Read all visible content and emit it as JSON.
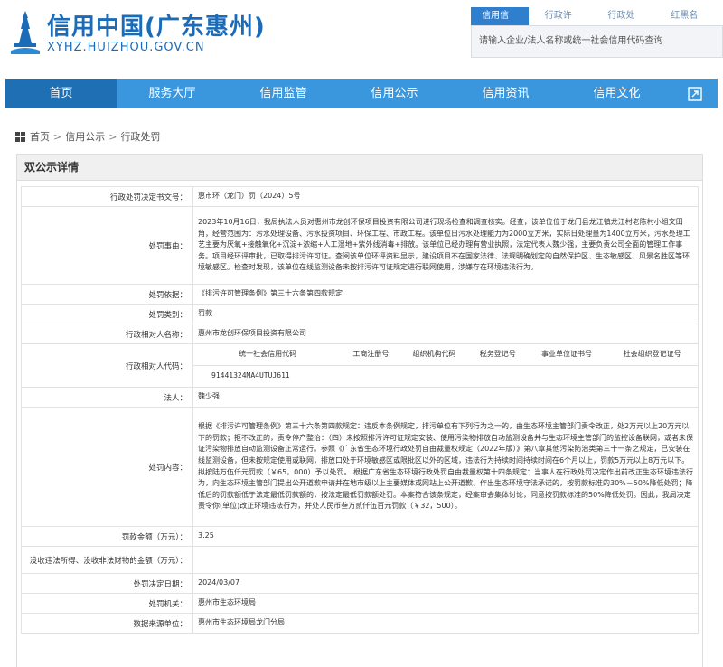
{
  "header": {
    "title": "信用中国(广东惠州)",
    "domain": "XYHZ.HUIZHOU.GOV.CN",
    "logo": "huizhou-tower-logo",
    "brand_color": "#1a6bb8"
  },
  "search": {
    "tabs": [
      "信用信息",
      "行政许可",
      "行政处罚",
      "红黑名单"
    ],
    "active_tab": 0,
    "placeholder": "请输入企业/法人名称或统一社会信用代码查询"
  },
  "nav": {
    "items": [
      "首页",
      "服务大厅",
      "信用监管",
      "信用公示",
      "信用资讯",
      "信用文化"
    ],
    "active": 0,
    "ext_icon": "expand-icon",
    "color": "#3a96dd"
  },
  "breadcrumb": [
    "首页",
    "信用公示",
    "行政处罚"
  ],
  "panel": {
    "title": "双公示详情",
    "rows": {
      "doc_no": {
        "label": "行政处罚决定书文号：",
        "value": "惠市环（龙门）罚（2024）5号"
      },
      "reason": {
        "label": "处罚事由：",
        "value": "2023年10月16日，我局执法人员对惠州市龙创环保项目投资有限公司进行现场检查和调查核实。经查，该单位位于龙门县龙江镇龙江村老陈村小组文田角，经营范围为：污水处理设备、污水投资项目、环保工程、市政工程。该单位日污水处理能力为2000立方米，实际日处理量为1400立方米，污水处理工艺主要为厌氧+接触氧化+沉淀+浓缩+人工湿地+紫外线消毒+排放。该单位已经办理有营业执照，法定代表人魏少强，主要负责公司全面的管理工作事务。项目经环评审批，已取得排污许可证。查阅该单位环评资料显示，建设项目不在国家法律、法规明确划定的自然保护区、生态敏感区、风景名胜区等环境敏感区。检查时发现，该单位在线监测设备未按排污许可证规定进行联网使用，涉嫌存在环境违法行为。"
      },
      "basis": {
        "label": "处罚依据：",
        "value": "《排污许可管理条例》第三十六条第四款规定"
      },
      "category": {
        "label": "处罚类别：",
        "value": "罚款"
      },
      "party": {
        "label": "行政相对人名称：",
        "value": "惠州市龙创环保项目投资有限公司"
      },
      "codes": {
        "label": "行政相对人代码：",
        "headers": [
          "统一社会信用代码",
          "工商注册号",
          "组织机构代码",
          "税务登记号",
          "事业单位证书号",
          "社会组织登记证号"
        ],
        "values": [
          "91441324MA4UTUJ611",
          "",
          "",
          "",
          "",
          ""
        ]
      },
      "legal_rep": {
        "label": "法人：",
        "value": "魏少强"
      },
      "content": {
        "label": "处罚内容：",
        "value": "根据《排污许可管理条例》第三十六条第四款规定：违反本条例规定，排污单位有下列行为之一的，由生态环境主管部门责令改正，处2万元以上20万元以下的罚款；拒不改正的，责令停产整治：（四）未按照排污许可证规定安装、使用污染物排放自动监测设备并与生态环境主管部门的监控设备联网，或者未保证污染物排放自动监测设备正常运行。参照《广东省生态环境行政处罚自由裁量权规定（2022年版）》第八章其他污染防治类第三十一条之规定，已安装在线监测设备，但未按规定使用或联网，排放口处于环境敏感区或限批区以外的区域，违法行为持续时间持续时间在6个月以上，罚款5万元以上8万元以下。拟按陆万伍仟元罚款（￥65，000）予以处罚。 根据广东省生态环境行政处罚自由裁量权第十四条规定：当事人在行政处罚决定作出前改正生态环境违法行为，向生态环境主管部门提出公开道歉申请并在地市级以上主要媒体或网站上公开道歉、作出生态环境守法承诺的，按罚款标准的30%－50%降低处罚；降低后的罚款额低于法定最低罚款额的，按法定最低罚款额处罚。本案符合该条规定，经案审会集体讨论，同意按罚款标准的50%降低处罚。因此，我局决定责令你(单位)改正环境违法行为，并处人民币叁万贰仟伍百元罚款（￥32，500）。"
      },
      "amount": {
        "label": "罚款金额（万元）：",
        "value": "3.25"
      },
      "confiscated": {
        "label": "没收违法所得、没收非法财物的金额（万元）：",
        "value": ""
      },
      "date": {
        "label": "处罚决定日期：",
        "value": "2024/03/07"
      },
      "authority": {
        "label": "处罚机关：",
        "value": "惠州市生态环境局"
      },
      "source": {
        "label": "数据来源单位：",
        "value": "惠州市生态环境局龙门分局"
      }
    }
  }
}
